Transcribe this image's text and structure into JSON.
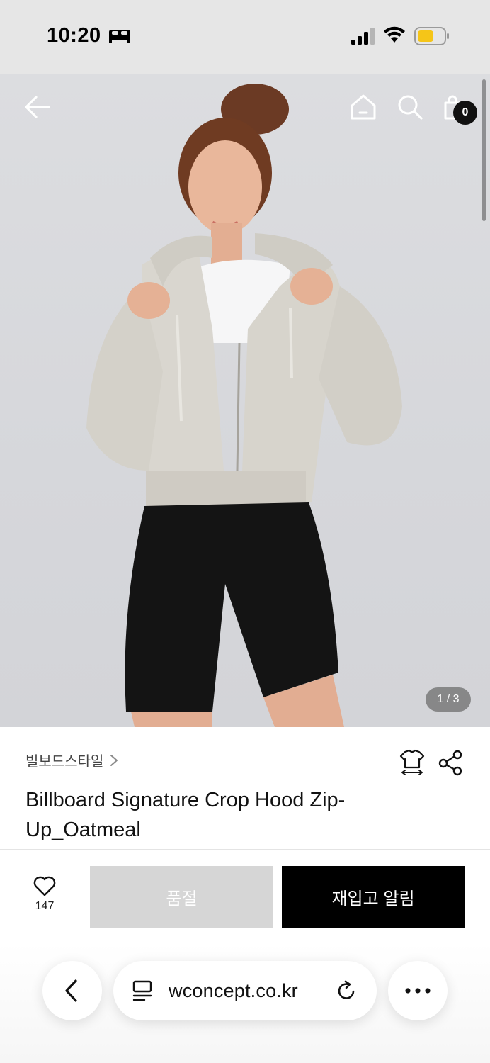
{
  "status_bar": {
    "time": "10:20",
    "icons": [
      "bed-icon",
      "signal-icon",
      "wifi-icon",
      "battery-icon"
    ],
    "battery_color": "#f5c518"
  },
  "hero": {
    "page_counter": "1 / 3",
    "cart_count": "0",
    "icons": [
      "back-arrow-icon",
      "home-icon",
      "search-icon",
      "shopping-bag-icon"
    ]
  },
  "product": {
    "brand": "빌보드스타일",
    "title": "Billboard Signature Crop Hood Zip-Up_Oatmeal",
    "icons": [
      "chevron-right-icon",
      "size-guide-icon",
      "share-icon"
    ]
  },
  "actions": {
    "like_count": "147",
    "soldout_label": "품절",
    "restock_label": "재입고 알림",
    "colors": {
      "soldout_bg": "#d6d6d6",
      "restock_bg": "#000000"
    }
  },
  "browser": {
    "url": "wconcept.co.kr",
    "icons": [
      "chevron-left-icon",
      "page-menu-icon",
      "reload-icon",
      "more-icon"
    ]
  }
}
